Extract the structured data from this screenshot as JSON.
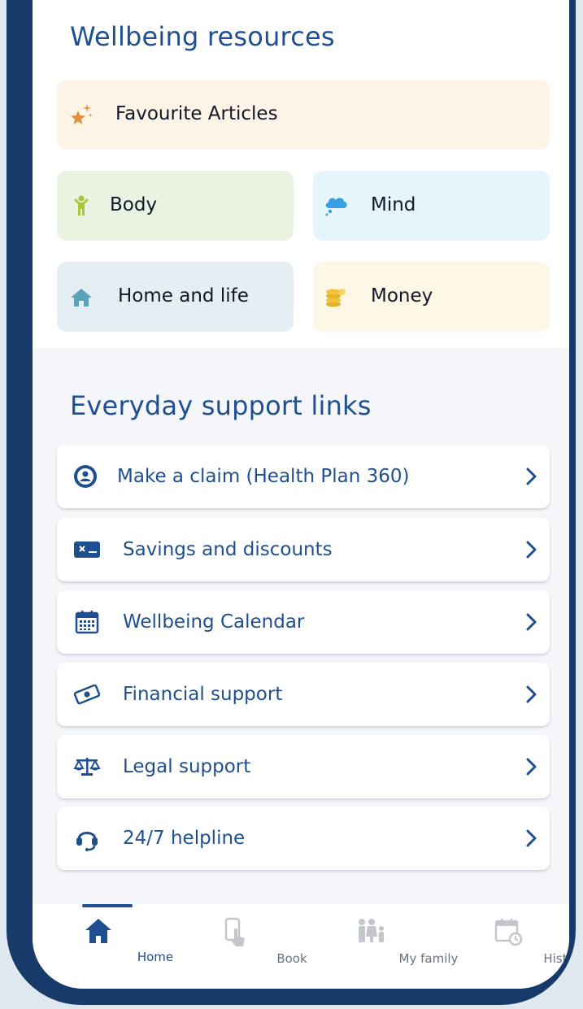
{
  "wellbeing": {
    "title": "Wellbeing resources",
    "tiles": [
      {
        "label": "Favourite Articles",
        "icon": "sparkle-star-icon",
        "bg": "#fdf3e7"
      },
      {
        "label": "Body",
        "icon": "person-body-icon",
        "bg": "#eaf2e1"
      },
      {
        "label": "Mind",
        "icon": "thought-cloud-icon",
        "bg": "#e6f4fc"
      },
      {
        "label": "Home and life",
        "icon": "house-icon",
        "bg": "#e5eff3"
      },
      {
        "label": "Money",
        "icon": "coins-icon",
        "bg": "#fdf8e6"
      }
    ]
  },
  "support": {
    "title": "Everyday support links",
    "links": [
      {
        "label": "Make a claim (Health Plan 360)",
        "icon": "claim-person-icon"
      },
      {
        "label": "Savings and discounts",
        "icon": "gift-card-icon"
      },
      {
        "label": "Wellbeing Calendar",
        "icon": "calendar-icon"
      },
      {
        "label": "Financial support",
        "icon": "banknote-icon"
      },
      {
        "label": "Legal support",
        "icon": "scales-icon"
      },
      {
        "label": "24/7 helpline",
        "icon": "headset-icon"
      }
    ]
  },
  "nav": {
    "items": [
      {
        "label": "Home",
        "icon": "home-icon",
        "active": true
      },
      {
        "label": "Book",
        "icon": "phone-tap-icon",
        "active": false
      },
      {
        "label": "My family",
        "icon": "family-icon",
        "active": false
      },
      {
        "label": "History",
        "icon": "calendar-clock-icon",
        "active": false
      }
    ]
  },
  "colors": {
    "accent": "#1f4f91",
    "frame": "#173a6b",
    "nav_inactive": "#6b7280"
  }
}
